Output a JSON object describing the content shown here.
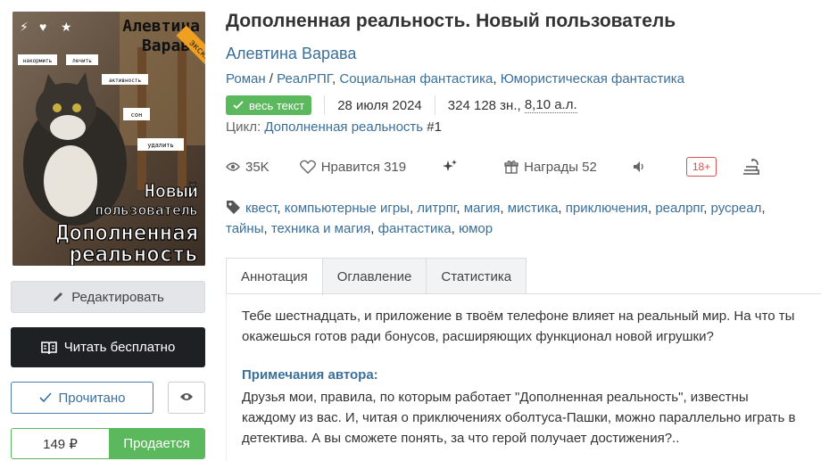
{
  "cover": {
    "badge": "эксклюзив",
    "author_text": "Алевтина Варава",
    "ui_words": [
      "накормить",
      "лечить",
      "активность",
      "сон",
      "удалить"
    ],
    "title_small": "Новый пользователь",
    "title_big": "Дополненная реальность"
  },
  "book": {
    "title": "Дополненная реальность. Новый пользователь",
    "author": "Алевтина Варава",
    "genres": [
      {
        "label": "Роман",
        "sep": " / "
      },
      {
        "label": "РеалРПГ",
        "sep": ", "
      },
      {
        "label": "Социальная фантастика",
        "sep": ", "
      },
      {
        "label": "Юмористическая фантастика",
        "sep": ""
      }
    ],
    "full_text_badge": "весь текст",
    "date": "28 июля 2024",
    "chars": "324 128 зн., ",
    "al": "8,10 а.л.",
    "cycle_label": "Цикл:",
    "cycle_name": "Дополненная реальность",
    "cycle_num": "#1"
  },
  "stats": {
    "views": "35K",
    "likes_label": "Нравится",
    "likes": "319",
    "awards_label": "Награды",
    "awards": "52",
    "age": "18+"
  },
  "tags": [
    "квест",
    "компьютерные игры",
    "литрпг",
    "магия",
    "мистика",
    "приключения",
    "реалрпг",
    "русреал",
    "тайны",
    "техника и магия",
    "фантастика",
    "юмор"
  ],
  "actions": {
    "edit": "Редактировать",
    "read": "Читать бесплатно",
    "done": "Прочитано",
    "price": "149 ₽",
    "sale": "Продается"
  },
  "tabs": [
    "Аннотация",
    "Оглавление",
    "Статистика"
  ],
  "annotation": {
    "text": "Тебе шестнадцать, и приложение в твоём телефоне влияет на реальный мир. На что ты окажешься готов ради бонусов, расширяющих функционал новой игрушки?",
    "notes_title": "Примечания автора:",
    "notes": "Друзья мои, правила, по которым работает \"Дополненная реальность\", известны каждому из вас. И, читая о приключениях оболтуса-Пашки, можно параллельно играть в детектива. А вы сможете понять, за что герой получает достижения?.."
  },
  "colors": {
    "accent": "#3a6f9a",
    "green": "#5cb85c",
    "dark": "#1e2124",
    "badge_orange": "#f0a020",
    "age_red": "#d9534f"
  }
}
